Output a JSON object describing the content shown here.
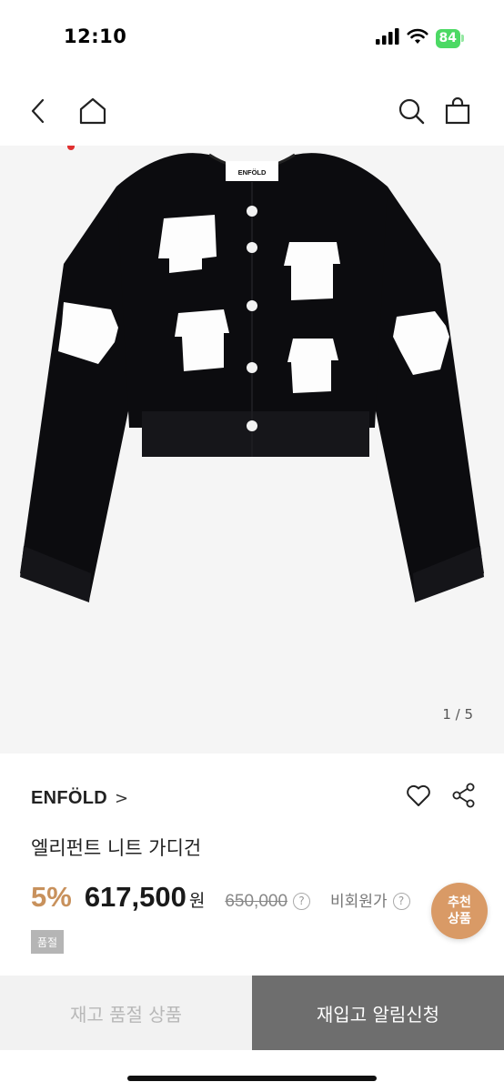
{
  "status_bar": {
    "time": "12:10",
    "battery": "84"
  },
  "product": {
    "image_counter": "1 / 5",
    "image_label": "ENFÖLD",
    "brand": "ENFÖLD",
    "brand_chevron": ">",
    "name": "엘리펀트 니트 가디건",
    "discount": "5%",
    "price": "617,500",
    "currency": "원",
    "original_price": "650,000",
    "question_mark": "?",
    "member_price_label": "비회원가",
    "soldout_badge": "품절"
  },
  "recommend": {
    "line1": "추천",
    "line2": "상품"
  },
  "bottom_bar": {
    "soldout_label": "재고 품절 상품",
    "restock_label": "재입고 알림신청"
  },
  "colors": {
    "accent": "#c8915c",
    "recommend_bg": "#d99a66",
    "button_dark": "#6e6e6e",
    "battery": "#4cd964"
  },
  "icons": [
    "signal-icon",
    "wifi-icon",
    "battery-icon",
    "back-icon",
    "home-icon",
    "search-icon",
    "bag-icon",
    "heart-icon",
    "share-icon",
    "help-icon"
  ]
}
